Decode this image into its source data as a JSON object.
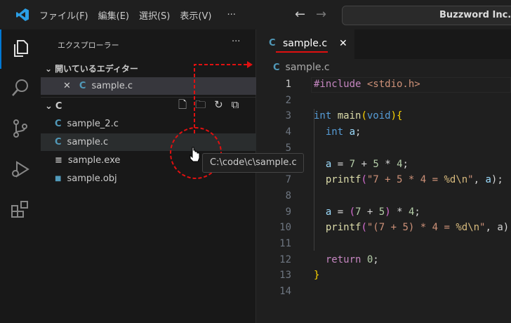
{
  "titlebar": {
    "menus": [
      "ファイル(F)",
      "編集(E)",
      "選択(S)",
      "表示(V)",
      "···"
    ],
    "search_text": "Buzzword Inc."
  },
  "sidebar": {
    "title": "エクスプローラー",
    "more": "···",
    "open_editors_label": "開いているエディター",
    "open_editors": [
      {
        "name": "sample.c",
        "icon": "C"
      }
    ],
    "folder_label": "C",
    "files": [
      {
        "name": "sample_2.c",
        "icon": "C"
      },
      {
        "name": "sample.c",
        "icon": "C"
      },
      {
        "name": "sample.exe",
        "icon": "≡"
      },
      {
        "name": "sample.obj",
        "icon": "■"
      }
    ]
  },
  "tooltip": "C:\\code\\c\\sample.c",
  "editor": {
    "tab": {
      "icon": "C",
      "label": "sample.c",
      "close": "✕"
    },
    "breadcrumb": {
      "icon": "C",
      "label": "sample.c"
    },
    "lines": [
      [
        [
          "#include ",
          "p"
        ],
        [
          "<stdio.h>",
          "s"
        ]
      ],
      [],
      [
        [
          "int ",
          "k"
        ],
        [
          "main",
          "f"
        ],
        [
          "(",
          "y"
        ],
        [
          "void",
          "k"
        ],
        [
          ")",
          "y"
        ],
        [
          "{",
          "y"
        ]
      ],
      [
        [
          "  int ",
          "k"
        ],
        [
          "a",
          "v"
        ],
        [
          ";",
          "w"
        ]
      ],
      [],
      [
        [
          "  a",
          "v"
        ],
        [
          " = ",
          "w"
        ],
        [
          "7",
          "n"
        ],
        [
          " + ",
          "w"
        ],
        [
          "5",
          "n"
        ],
        [
          " * ",
          "w"
        ],
        [
          "4",
          "n"
        ],
        [
          ";",
          "w"
        ]
      ],
      [
        [
          "  printf",
          "f"
        ],
        [
          "(",
          "m"
        ],
        [
          "\"7 + 5 * 4 = ",
          "s"
        ],
        [
          "%d\\n",
          "e"
        ],
        [
          "\"",
          "s"
        ],
        [
          ", ",
          "w"
        ],
        [
          "a",
          "v"
        ],
        [
          ");",
          "w"
        ]
      ],
      [],
      [
        [
          "  a",
          "v"
        ],
        [
          " = ",
          "w"
        ],
        [
          "(",
          "m"
        ],
        [
          "7",
          "n"
        ],
        [
          " + ",
          "w"
        ],
        [
          "5",
          "n"
        ],
        [
          ")",
          "m"
        ],
        [
          " * ",
          "w"
        ],
        [
          "4",
          "n"
        ],
        [
          ";",
          "w"
        ]
      ],
      [
        [
          "  printf",
          "f"
        ],
        [
          "(",
          "m"
        ],
        [
          "\"(7 + 5) * 4 = ",
          "s"
        ],
        [
          "%d\\n",
          "e"
        ],
        [
          "\"",
          "s"
        ],
        [
          ", a);",
          "w"
        ]
      ],
      [],
      [
        [
          "  return ",
          "p"
        ],
        [
          "0",
          "n"
        ],
        [
          ";",
          "w"
        ]
      ],
      [
        [
          "}",
          "y"
        ]
      ],
      []
    ]
  },
  "colors": {
    "accent": "#0078d4",
    "annotation": "#e01010"
  }
}
